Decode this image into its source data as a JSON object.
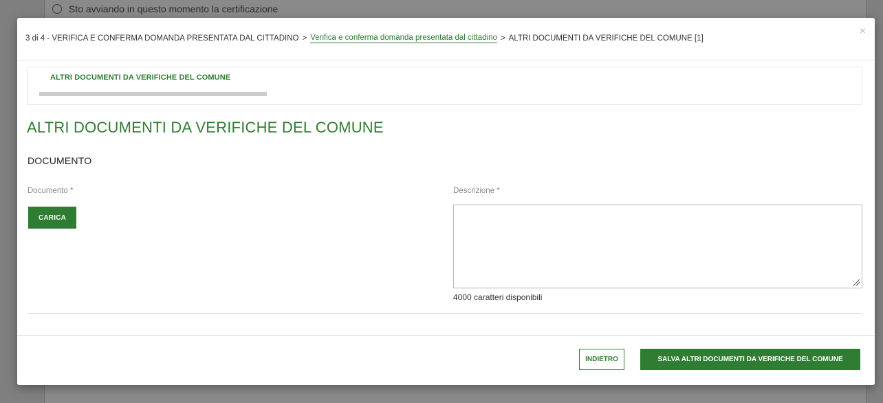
{
  "background": {
    "radio_label": "Sto avviando in questo momento la certificazione"
  },
  "modal": {
    "breadcrumb": {
      "step": "3 di 4 - VERIFICA E CONFERMA DOMANDA PRESENTATA DAL CITTADINO",
      "link": "Verifica e conferma domanda presentata dal cittadino",
      "current": "ALTRI DOCUMENTI DA VERIFICHE DEL COMUNE [1]",
      "separator": ">"
    },
    "close_label": "×",
    "tab_label": "ALTRI DOCUMENTI DA VERIFICHE DEL COMUNE",
    "section_title": "ALTRI DOCUMENTI DA VERIFICHE DEL COMUNE",
    "subsection_title": "DOCUMENTO",
    "documento_label": "Documento *",
    "carica_label": "CARICA",
    "descrizione_label": "Descrizione *",
    "descrizione_value": "",
    "char_count": "4000 caratteri disponibili",
    "indietro_label": "INDIETRO",
    "salva_label": "SALVA ALTRI DOCUMENTI DA VERIFICHE DEL COMUNE"
  },
  "colors": {
    "accent": "#2e7d32",
    "overlay": "#7f7f7f"
  }
}
